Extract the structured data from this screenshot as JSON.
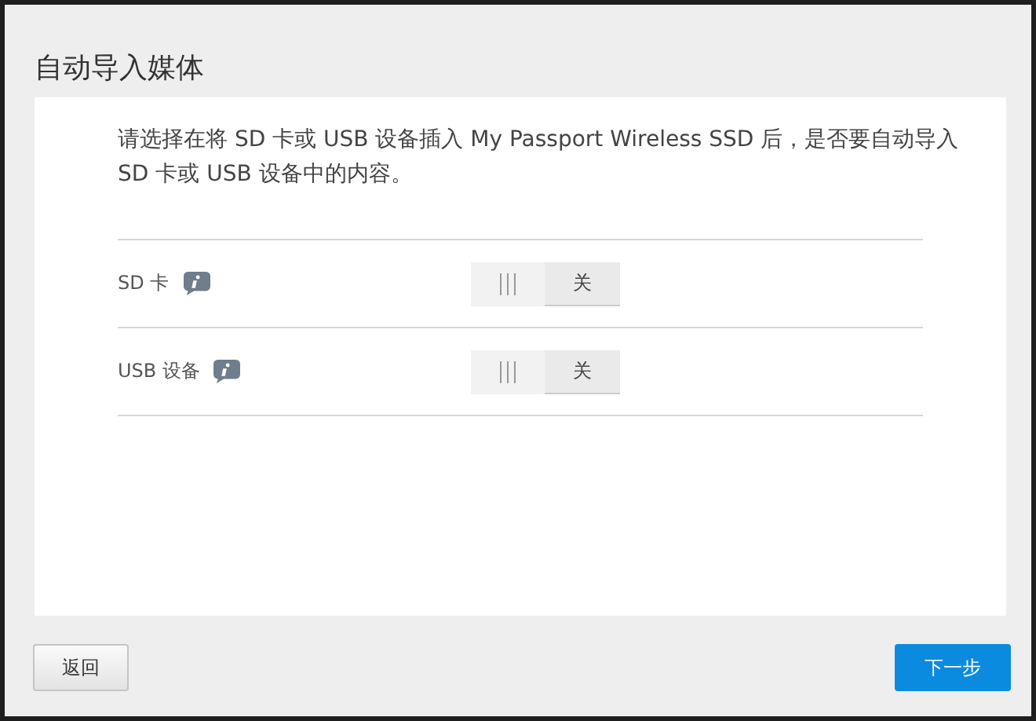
{
  "title": "自动导入媒体",
  "description": "请选择在将 SD 卡或 USB 设备插入 My Passport Wireless SSD 后，是否要自动导入 SD 卡或 USB 设备中的内容。",
  "settings": [
    {
      "label": "SD 卡",
      "on": false,
      "state_label": "关"
    },
    {
      "label": "USB 设备",
      "on": false,
      "state_label": "关"
    }
  ],
  "buttons": [
    {
      "label": "返回",
      "kind": "secondary"
    },
    {
      "label": "下一步",
      "kind": "primary"
    }
  ]
}
